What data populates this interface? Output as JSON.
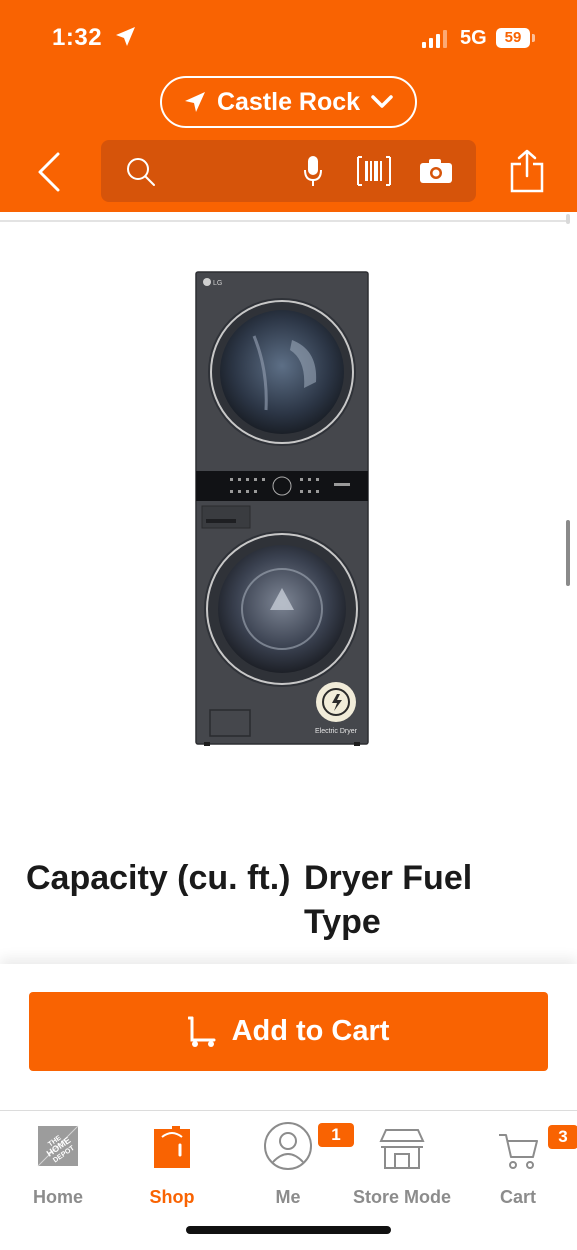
{
  "status_bar": {
    "time": "1:32",
    "network": "5G",
    "battery": "59"
  },
  "header": {
    "store_name": "Castle Rock",
    "search": {
      "placeholder": "",
      "value": ""
    }
  },
  "product": {
    "image_brand_mark": "LG",
    "image_badge_label": "Electric Dryer",
    "specs": [
      {
        "heading": "Capacity (cu. ft.)"
      },
      {
        "heading": "Dryer Fuel Type"
      }
    ]
  },
  "actions": {
    "add_to_cart_label": "Add to Cart"
  },
  "tabbar": {
    "items": [
      {
        "label": "Home",
        "icon": "home-depot-logo-icon"
      },
      {
        "label": "Shop",
        "icon": "paint-bucket-icon",
        "active": true
      },
      {
        "label": "Me",
        "icon": "person-icon",
        "badge": "1"
      },
      {
        "label": "Store Mode",
        "icon": "store-icon"
      },
      {
        "label": "Cart",
        "icon": "cart-icon",
        "badge": "3"
      }
    ]
  },
  "colors": {
    "brand_orange": "#f96302",
    "search_bg": "#d6540a",
    "inactive_tab": "#8c8c8c"
  }
}
